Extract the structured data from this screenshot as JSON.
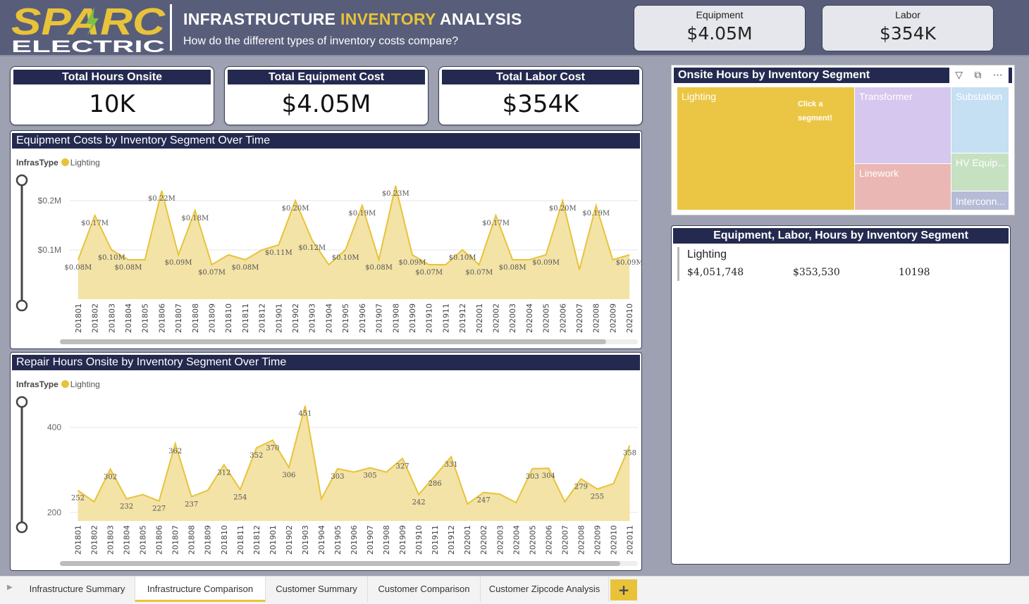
{
  "logo": {
    "line1": "SPARC",
    "line2": "ELECTRIC"
  },
  "header": {
    "title_part1": "INFRASTRUCTURE ",
    "title_highlight": "INVENTORY",
    "title_part2": " ANALYSIS",
    "subtitle": "How do the different types of inventory costs compare?"
  },
  "top_cards": [
    {
      "label": "Equipment",
      "value": "$4.05M"
    },
    {
      "label": "Labor",
      "value": "$354K"
    }
  ],
  "kpis": [
    {
      "label": "Total Hours Onsite",
      "value": "10K"
    },
    {
      "label": "Total Equipment Cost",
      "value": "$4.05M"
    },
    {
      "label": "Total Labor Cost",
      "value": "$354K"
    }
  ],
  "colors": {
    "accent": "#e8c33a",
    "navy": "#242a4f",
    "header": "#585e7a",
    "area_fill": "#f3e3a7"
  },
  "chart_data": [
    {
      "type": "area",
      "title": "Equipment Costs by Inventory Segment Over Time",
      "legend_title": "InfrasType",
      "series": [
        {
          "name": "Lighting",
          "values": [
            0.08,
            0.17,
            0.1,
            0.08,
            0.08,
            0.22,
            0.09,
            0.18,
            0.07,
            0.09,
            0.08,
            0.1,
            0.11,
            0.2,
            0.12,
            0.07,
            0.1,
            0.19,
            0.08,
            0.23,
            0.09,
            0.07,
            0.07,
            0.1,
            0.07,
            0.17,
            0.08,
            0.08,
            0.09,
            0.2,
            0.06,
            0.19,
            0.08,
            0.09
          ]
        }
      ],
      "x": [
        "201801",
        "201802",
        "201803",
        "201804",
        "201805",
        "201806",
        "201807",
        "201808",
        "201809",
        "201810",
        "201811",
        "201812",
        "201901",
        "201902",
        "201903",
        "201904",
        "201905",
        "201906",
        "201907",
        "201908",
        "201909",
        "201910",
        "201911",
        "201912",
        "202001",
        "202002",
        "202003",
        "202004",
        "202005",
        "202006",
        "202007",
        "202008",
        "202009",
        "202010"
      ],
      "data_labels": [
        "$0.08M",
        "$0.17M",
        "$0.10M",
        "$0.08M",
        "",
        "$0.22M",
        "$0.09M",
        "$0.18M",
        "$0.07M",
        "",
        "$0.08M",
        "",
        "$0.11M",
        "$0.20M",
        "$0.12M",
        "",
        "$0.10M",
        "$0.19M",
        "$0.08M",
        "$0.23M",
        "$0.09M",
        "$0.07M",
        "",
        "$0.10M",
        "$0.07M",
        "$0.17M",
        "$0.08M",
        "",
        "$0.09M",
        "$0.20M",
        "",
        "$0.19M",
        "",
        "$0.09M"
      ],
      "yticks": [
        "$0.1M",
        "$0.2M"
      ],
      "ytick_values": [
        0.1,
        0.2
      ],
      "ylim": [
        0,
        0.25
      ]
    },
    {
      "type": "area",
      "title": "Repair Hours Onsite by Inventory Segment Over Time",
      "legend_title": "InfrasType",
      "series": [
        {
          "name": "Lighting",
          "values": [
            252,
            225,
            302,
            232,
            242,
            227,
            362,
            237,
            252,
            312,
            254,
            352,
            370,
            306,
            451,
            232,
            303,
            295,
            305,
            295,
            327,
            242,
            286,
            331,
            220,
            247,
            243,
            223,
            303,
            304,
            225,
            279,
            255,
            268,
            358
          ]
        }
      ],
      "x": [
        "201801",
        "201802",
        "201803",
        "201804",
        "201805",
        "201806",
        "201807",
        "201808",
        "201809",
        "201810",
        "201811",
        "201812",
        "201901",
        "201902",
        "201903",
        "201904",
        "201905",
        "201906",
        "201907",
        "201908",
        "201909",
        "201910",
        "201911",
        "201912",
        "202001",
        "202002",
        "202003",
        "202004",
        "202005",
        "202006",
        "202007",
        "202008",
        "202009",
        "202010",
        "202011"
      ],
      "data_labels": [
        "252",
        "",
        "302",
        "232",
        "",
        "227",
        "362",
        "237",
        "",
        "312",
        "254",
        "352",
        "370",
        "306",
        "451",
        "",
        "303",
        "",
        "305",
        "",
        "327",
        "242",
        "286",
        "331",
        "",
        "247",
        "",
        "",
        "303",
        "304",
        "",
        "279",
        "255",
        "",
        "358"
      ],
      "yticks": [
        "200",
        "400"
      ],
      "ytick_values": [
        200,
        400
      ],
      "ylim": [
        180,
        470
      ]
    }
  ],
  "treemap": {
    "title": "Onsite Hours by Inventory Segment",
    "tools": [
      "filter-icon",
      "focus-icon",
      "more-icon"
    ],
    "hint": "Click a segment!",
    "cells": [
      {
        "label": "Lighting",
        "color": "#ebc644"
      },
      {
        "label": "Transformer",
        "color": "#d5c7ee"
      },
      {
        "label": "Substation",
        "color": "#c5dff3"
      },
      {
        "label": "Linework",
        "color": "#ebb7b4"
      },
      {
        "label": "HV Equip...",
        "color": "#c6e1c2"
      },
      {
        "label": "Interconn...",
        "color": "#b6bbd6"
      }
    ]
  },
  "matrix": {
    "title": "Equipment, Labor, Hours by Inventory Segment",
    "row_label": "Lighting",
    "equipment": "$4,051,748",
    "labor": "$353,530",
    "hours": "10198"
  },
  "tabs": [
    "Infrastructure Summary",
    "Infrastructure Comparison",
    "Customer Summary",
    "Customer Comparison",
    "Customer Zipcode Analysis"
  ],
  "active_tab": "Infrastructure Comparison",
  "add_tab": "+"
}
